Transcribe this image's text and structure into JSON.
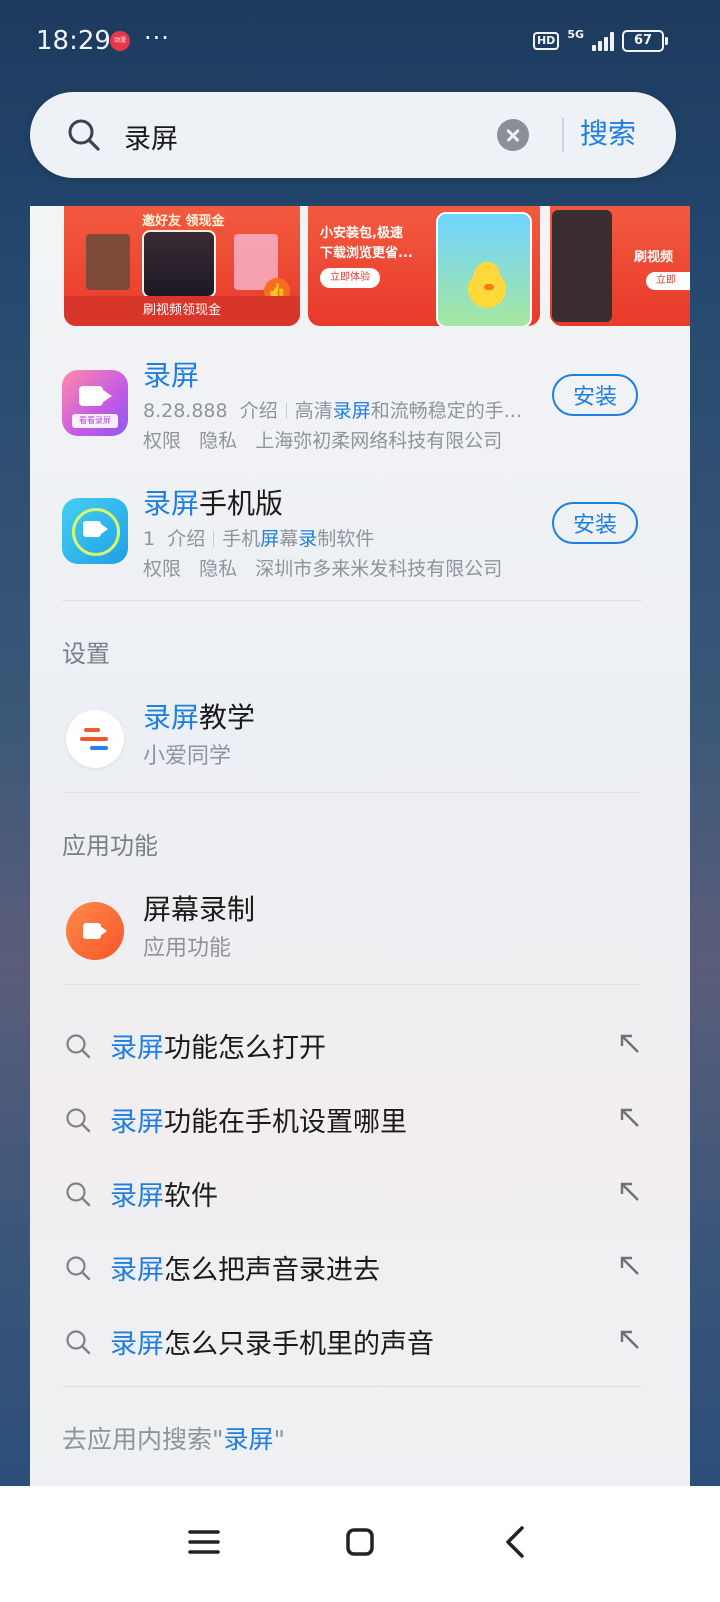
{
  "status_bar": {
    "time": "18:29",
    "notif_badge": "动漫",
    "more": "···",
    "hd": "HD",
    "network": "5G",
    "battery": "67"
  },
  "search": {
    "query": "录屏",
    "submit_label": "搜索"
  },
  "banners": [
    {
      "headline": "邀好友 领现金",
      "caption": "刷视频领现金"
    },
    {
      "text_line1": "小安装包,极速",
      "text_line2": "下载浏览更省...",
      "cta": "立即体验"
    },
    {
      "text": "刷视频",
      "cta": "立即"
    }
  ],
  "apps": [
    {
      "title_highlight": "录屏",
      "title_rest": "",
      "icon_label": "看看录屏",
      "version": "8.28.888",
      "intro": "介绍",
      "desc_pre": "高清",
      "desc_hl": "录屏",
      "desc_post": "和流畅稳定的手...",
      "permissions": "权限",
      "privacy": "隐私",
      "developer": "上海弥初柔网络科技有限公司",
      "install": "安装"
    },
    {
      "title_highlight": "录屏",
      "title_rest": "手机版",
      "version": "1",
      "intro": "介绍",
      "desc_pre": "手机",
      "desc_hl": "屏",
      "desc_mid": "幕",
      "desc_hl2": "录",
      "desc_post": "制软件",
      "permissions": "权限",
      "privacy": "隐私",
      "developer": "深圳市多来米发科技有限公司",
      "install": "安装"
    }
  ],
  "settings_section": {
    "title": "设置",
    "item_hl": "录屏",
    "item_rest": "教学",
    "item_sub": "小爱同学"
  },
  "features_section": {
    "title": "应用功能",
    "item_title": "屏幕录制",
    "item_sub": "应用功能"
  },
  "suggestions": [
    {
      "hl": "录屏",
      "rest": "功能怎么打开"
    },
    {
      "hl": "录屏",
      "rest": "功能在手机设置哪里"
    },
    {
      "hl": "录屏",
      "rest": "软件"
    },
    {
      "hl": "录屏",
      "rest": "怎么把声音录进去"
    },
    {
      "hl": "录屏",
      "rest": "怎么只录手机里的声音"
    }
  ],
  "in_app_search": {
    "prefix": "去应用内搜索\"",
    "hl": "录屏",
    "suffix": "\""
  },
  "colors": {
    "accent": "#1f7fe0",
    "banner_red": "#e83a2c"
  },
  "icons": [
    "search-icon",
    "clear-icon",
    "like-icon",
    "fill-arrow-icon",
    "menu-icon",
    "home-icon",
    "back-icon"
  ]
}
